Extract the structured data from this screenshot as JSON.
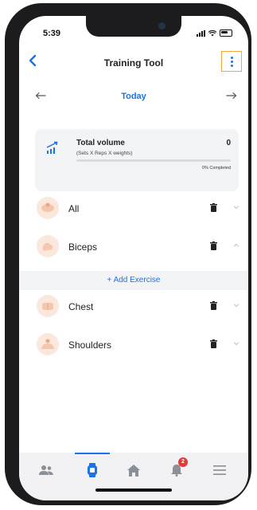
{
  "status": {
    "time": "5:39"
  },
  "header": {
    "title": "Training Tool"
  },
  "date_nav": {
    "label": "Today",
    "prev_icon": "arrow-left-icon",
    "next_icon": "arrow-right-icon"
  },
  "summary": {
    "title": "Total volume",
    "subtitle": "(Sets X Reps X weights)",
    "value": "0",
    "progress_label": "0% Completed",
    "progress_fraction": 0
  },
  "muscles": [
    {
      "label": "All",
      "expanded": false
    },
    {
      "label": "Biceps",
      "expanded": true
    },
    {
      "label": "Chest",
      "expanded": false
    },
    {
      "label": "Shoulders",
      "expanded": false
    }
  ],
  "add_exercise": {
    "label": "+ Add Exercise"
  },
  "tabbar": {
    "items": [
      {
        "icon": "people-icon"
      },
      {
        "icon": "watch-icon",
        "active": true
      },
      {
        "icon": "home-icon"
      },
      {
        "icon": "bell-icon",
        "badge": "2"
      },
      {
        "icon": "menu-icon"
      }
    ]
  },
  "colors": {
    "accent": "#1a73e8",
    "badge": "#e53935",
    "highlight": "#f2a93b"
  }
}
